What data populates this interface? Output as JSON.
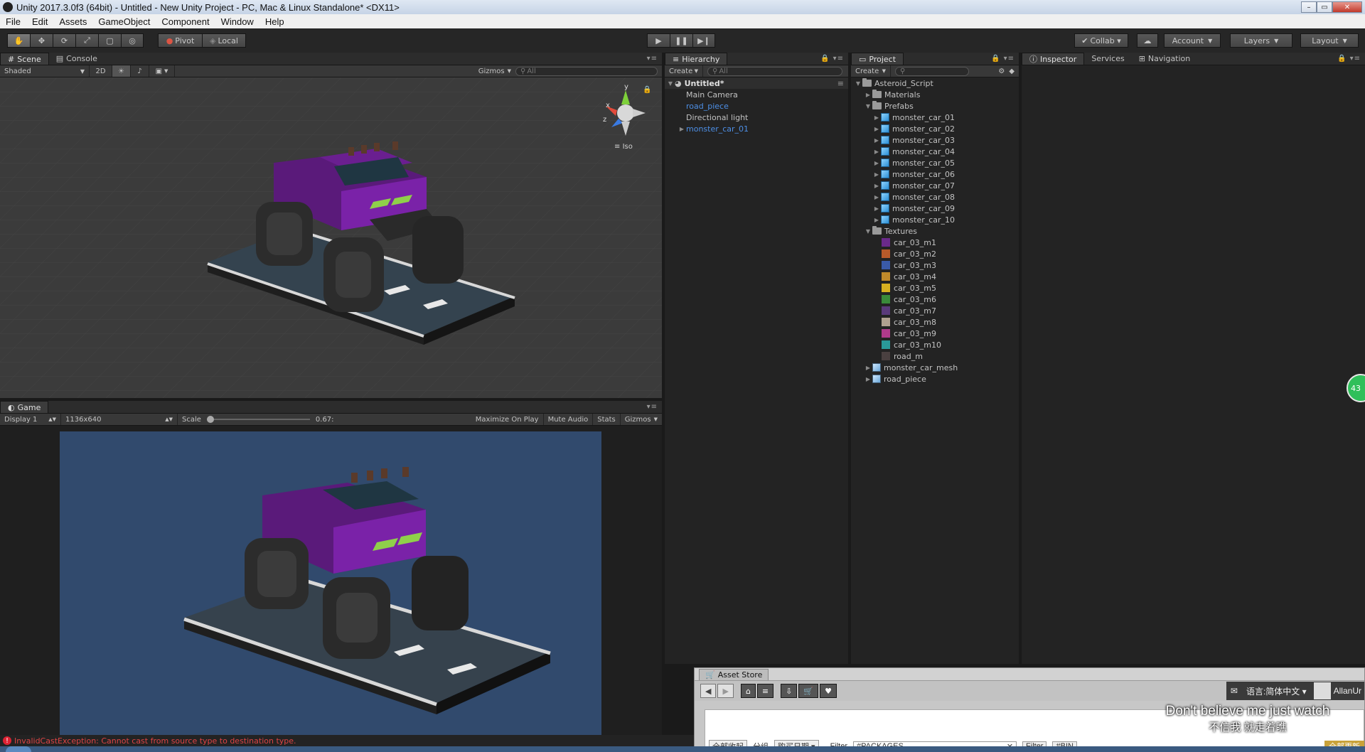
{
  "window": {
    "title": "Unity 2017.3.0f3 (64bit) - Untitled - New Unity Project - PC, Mac & Linux Standalone* <DX11>",
    "minimize": "–",
    "maximize": "▭",
    "close": "✕"
  },
  "menu": [
    "File",
    "Edit",
    "Assets",
    "GameObject",
    "Component",
    "Window",
    "Help"
  ],
  "toolbar": {
    "tools": [
      "hand-icon",
      "move-icon",
      "rotate-icon",
      "scale-icon",
      "rect-icon",
      "transform-icon"
    ],
    "pivot": "Pivot",
    "local": "Local",
    "collab": "Collab ▾",
    "account": "Account",
    "layers": "Layers",
    "layout": "Layout"
  },
  "scene": {
    "tabs": [
      "Scene",
      "Console"
    ],
    "shading": "Shaded",
    "mode2d": "2D",
    "gizmos": "Gizmos",
    "search_placeholder": "All",
    "projection": "Iso",
    "axis_labels": {
      "x": "x",
      "y": "y",
      "z": "z"
    }
  },
  "game": {
    "tab": "Game",
    "display": "Display 1",
    "resolution": "1136x640",
    "scale_label": "Scale",
    "scale_value": "0.67:",
    "scale_fraction": 0.0,
    "maximize": "Maximize On Play",
    "mute": "Mute Audio",
    "stats": "Stats",
    "gizmos": "Gizmos"
  },
  "hierarchy": {
    "tab": "Hierarchy",
    "create": "Create",
    "search_placeholder": "All",
    "scene_name": "Untitled*",
    "items": [
      {
        "label": "Main Camera",
        "prefab": false,
        "expandable": false
      },
      {
        "label": "road_piece",
        "prefab": true,
        "expandable": false
      },
      {
        "label": "Directional light",
        "prefab": false,
        "expandable": false
      },
      {
        "label": "monster_car_01",
        "prefab": true,
        "expandable": true
      }
    ]
  },
  "project": {
    "tab": "Project",
    "create": "Create",
    "root": "Asteroid_Script",
    "materials": "Materials",
    "prefabs_folder": "Prefabs",
    "prefabs": [
      "monster_car_01",
      "monster_car_02",
      "monster_car_03",
      "monster_car_04",
      "monster_car_05",
      "monster_car_06",
      "monster_car_07",
      "monster_car_08",
      "monster_car_09",
      "monster_car_10"
    ],
    "textures_folder": "Textures",
    "textures": [
      {
        "label": "car_03_m1",
        "color": "#6a2a8a"
      },
      {
        "label": "car_03_m2",
        "color": "#b85a2a"
      },
      {
        "label": "car_03_m3",
        "color": "#3a5aa8"
      },
      {
        "label": "car_03_m4",
        "color": "#c08a2a"
      },
      {
        "label": "car_03_m5",
        "color": "#d8b020"
      },
      {
        "label": "car_03_m6",
        "color": "#3a8a3a"
      },
      {
        "label": "car_03_m7",
        "color": "#5a3a7a"
      },
      {
        "label": "car_03_m8",
        "color": "#b0a090"
      },
      {
        "label": "car_03_m9",
        "color": "#b03a8a"
      },
      {
        "label": "car_03_m10",
        "color": "#2a9a9a"
      },
      {
        "label": "road_m",
        "color": "#4a4040"
      }
    ],
    "mesh": "monster_car_mesh",
    "road": "road_piece"
  },
  "inspector": {
    "tabs": [
      "Inspector",
      "Services",
      "Navigation"
    ]
  },
  "asset_store": {
    "tab": "Asset Store",
    "language": "语言:简体中文",
    "user": "AllanUr",
    "collapse_all": "全部收起",
    "group_label": "分组",
    "group_value": "购买日期",
    "filter_label": "Filter",
    "filter_value": "#PACKAGES",
    "filter_button": "Filter",
    "bin": "#BIN",
    "update_all": "全部更新"
  },
  "subtitle": {
    "en": "Don't believe me just watch",
    "zh": "不信我 就走着瞧"
  },
  "status": {
    "error": "InvalidCastException: Cannot cast from source type to destination type."
  },
  "side_badge": "43"
}
